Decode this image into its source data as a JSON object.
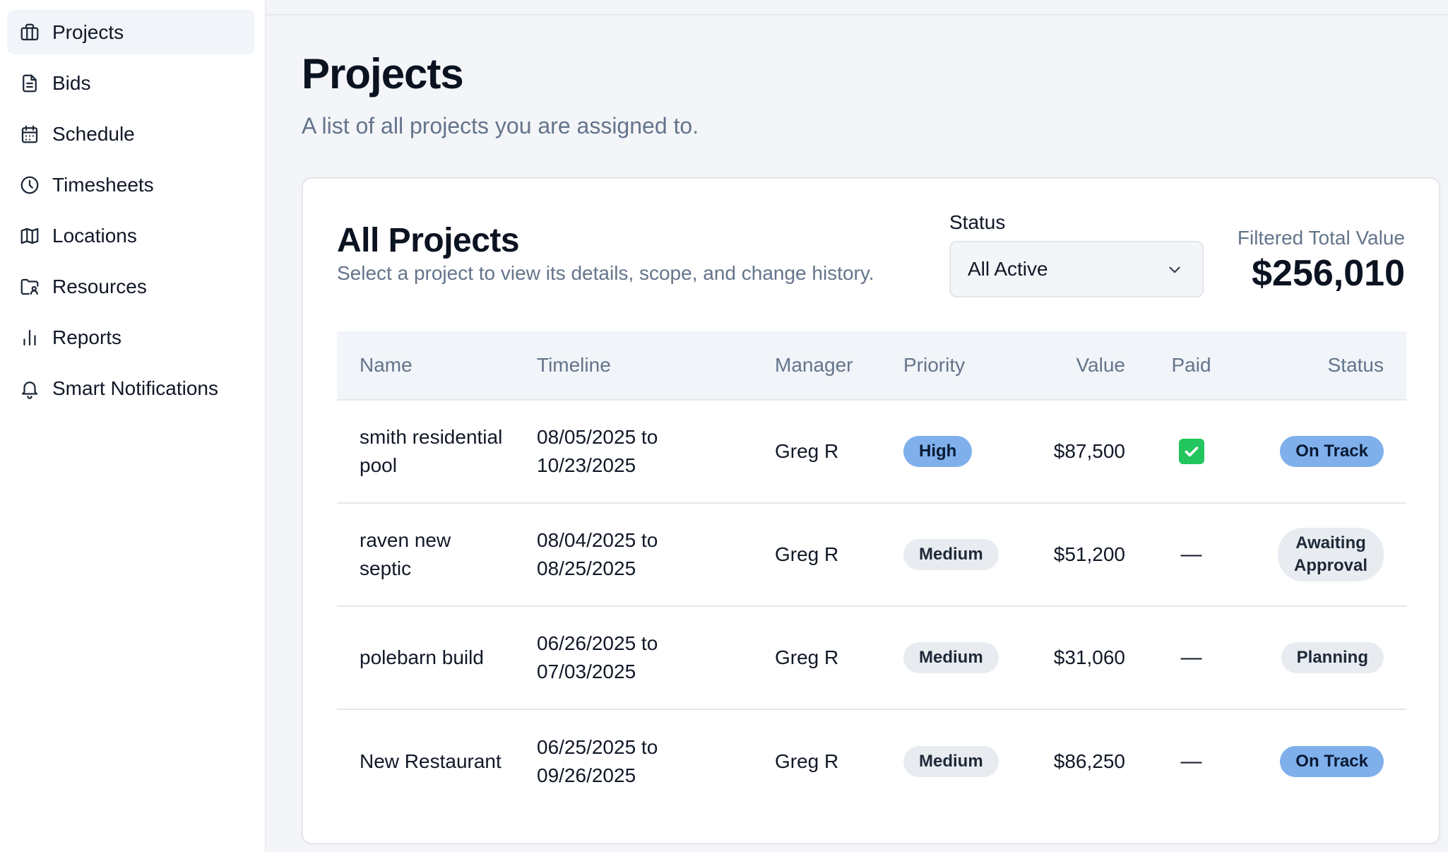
{
  "sidebar": {
    "items": [
      {
        "label": "Projects",
        "icon": "briefcase-icon",
        "active": true
      },
      {
        "label": "Bids",
        "icon": "document-icon"
      },
      {
        "label": "Schedule",
        "icon": "calendar-icon"
      },
      {
        "label": "Timesheets",
        "icon": "clock-icon"
      },
      {
        "label": "Locations",
        "icon": "map-icon"
      },
      {
        "label": "Resources",
        "icon": "folder-user-icon"
      },
      {
        "label": "Reports",
        "icon": "bar-chart-icon"
      },
      {
        "label": "Smart Notifications",
        "icon": "bell-icon"
      }
    ]
  },
  "page": {
    "title": "Projects",
    "subtitle": "A list of all projects you are assigned to."
  },
  "card": {
    "title": "All Projects",
    "subtitle": "Select a project to view its details, scope, and change history.",
    "status_filter": {
      "label": "Status",
      "value": "All Active"
    },
    "total": {
      "label": "Filtered Total Value",
      "value": "$256,010"
    }
  },
  "table": {
    "columns": [
      "Name",
      "Timeline",
      "Manager",
      "Priority",
      "Value",
      "Paid",
      "Status"
    ],
    "rows": [
      {
        "name": "smith residential pool",
        "timeline": "08/05/2025 to 10/23/2025",
        "manager": "Greg R",
        "priority": "High",
        "value": "$87,500",
        "paid": true,
        "status": "On Track"
      },
      {
        "name": "raven new septic",
        "timeline": "08/04/2025 to 08/25/2025",
        "manager": "Greg R",
        "priority": "Medium",
        "value": "$51,200",
        "paid": "—",
        "status": "Awaiting Approval"
      },
      {
        "name": "polebarn build",
        "timeline": "06/26/2025 to 07/03/2025",
        "manager": "Greg R",
        "priority": "Medium",
        "value": "$31,060",
        "paid": "—",
        "status": "Planning"
      },
      {
        "name": "New Restaurant",
        "timeline": "06/25/2025 to 09/26/2025",
        "manager": "Greg R",
        "priority": "Medium",
        "value": "$86,250",
        "paid": "—",
        "status": "On Track"
      }
    ]
  },
  "colors": {
    "badge_blue": "#7fb0ec",
    "badge_gray": "#e8ecf1",
    "paid_check": "#22c55e"
  }
}
